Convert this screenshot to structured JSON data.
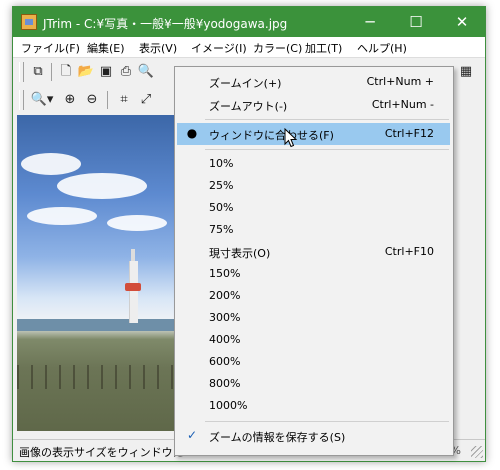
{
  "window": {
    "title": "JTrim - C:¥写真・一般¥一般¥yodogawa.jpg",
    "minimize": "─",
    "maximize": "☐",
    "close": "✕"
  },
  "menubar": [
    "ファイル(F)",
    "編集(E)",
    "表示(V)",
    "イメージ(I)",
    "カラー(C)",
    "加工(T)",
    "ヘルプ(H)"
  ],
  "toolbar_icons": {
    "row1": [
      "capture-icon",
      "new-icon",
      "open-icon",
      "save-icon",
      "print-icon",
      "print-preview-icon"
    ],
    "row2": [
      "zoom-dropdown-icon",
      "zoom-in-icon",
      "zoom-out-icon",
      "crop-icon",
      "resize-icon"
    ]
  },
  "zoom_menu": {
    "items": [
      {
        "label": "ズームイン(+)",
        "shortcut": "Ctrl+Num +"
      },
      {
        "label": "ズームアウト(-)",
        "shortcut": "Ctrl+Num -"
      },
      {
        "label": "ウィンドウに合わせる(F)",
        "shortcut": "Ctrl+F12",
        "mark": "●",
        "highlighted": true
      },
      {
        "label": "10%"
      },
      {
        "label": "25%"
      },
      {
        "label": "50%"
      },
      {
        "label": "75%"
      },
      {
        "label": "現寸表示(O)",
        "shortcut": "Ctrl+F10"
      },
      {
        "label": "150%"
      },
      {
        "label": "200%"
      },
      {
        "label": "300%"
      },
      {
        "label": "400%"
      },
      {
        "label": "600%"
      },
      {
        "label": "800%"
      },
      {
        "label": "1000%"
      },
      {
        "label": "ズームの情報を保存する(S)",
        "mark": "✓"
      }
    ]
  },
  "statusbar": {
    "text": "画像の表示サイズをウィンドウに",
    "right": "2%"
  },
  "colors": {
    "titlebar": "#3b923b",
    "highlight": "#99c9ef"
  }
}
